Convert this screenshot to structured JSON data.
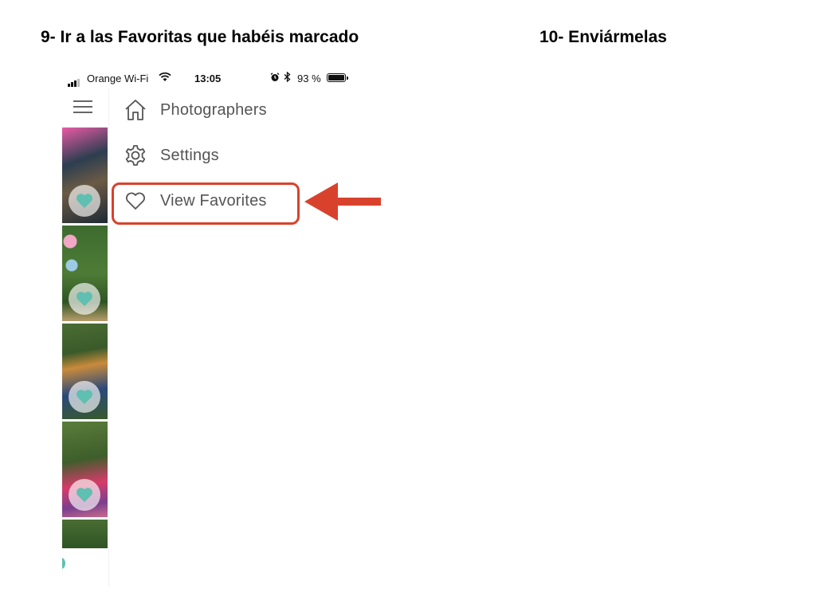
{
  "instructions": {
    "step9": "9- Ir a las Favoritas que habéis marcado",
    "step10": "10- Enviármelas"
  },
  "status_bar": {
    "carrier": "Orange Wi-Fi",
    "time": "13:05",
    "battery": "93 %"
  },
  "menu": {
    "items": [
      {
        "label": "Photographers",
        "icon": "home-icon"
      },
      {
        "label": "Settings",
        "icon": "gear-icon"
      },
      {
        "label": "View Favorites",
        "icon": "heart-icon"
      }
    ]
  },
  "colors": {
    "annotation": "#d8422d",
    "favorite_teal": "#5fbfb0",
    "menu_text": "#555555"
  }
}
